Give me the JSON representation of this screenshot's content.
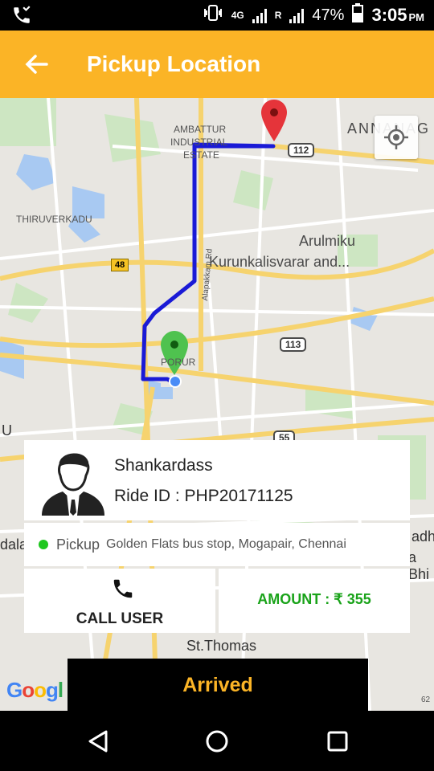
{
  "status_bar": {
    "network": "4G",
    "sim2_label": "R",
    "battery": "47%",
    "time": "3:05",
    "ampm": "PM"
  },
  "app_bar": {
    "title": "Pickup Location"
  },
  "map": {
    "labels": {
      "ambattur": "AMBATTUR",
      "industrial": "INDUSTRIAL",
      "estate": "ESTATE",
      "thiruverkadu": "THIRUVERKADU",
      "anna_nagar": "ANNANAG",
      "arulmiku": "Arulmiku",
      "kurunkalisvarar": "Kurunkalisvarar and...",
      "alapakkam_rd": "Alapakkam Rd",
      "porur": "PORUR",
      "st_thomas": "St.Thomas",
      "adhi": "adhi",
      "bhi": "a Bhi",
      "dala": "dala",
      "u": "U",
      "sixtytwo": "62"
    },
    "shields": {
      "r112": "112",
      "r113": "113",
      "r55": "55",
      "r48": "48"
    },
    "google_logo": "Google"
  },
  "ride": {
    "user_name": "Shankardass",
    "ride_id": "Ride ID : PHP20171125",
    "pickup_label": "Pickup",
    "pickup_address": "Golden Flats bus stop, Mogapair, Chennai",
    "call_label": "CALL USER",
    "amount": "AMOUNT : ₹ 355",
    "action_label": "Arrived"
  },
  "colors": {
    "accent": "#fbb426",
    "route": "#1a1ad6",
    "pickup_dot": "#1ec71e",
    "amount_text": "#1aa31a"
  },
  "icons": [
    "missed-call-icon",
    "vibrate-icon",
    "signal-icon",
    "battery-icon",
    "back-arrow-icon",
    "my-location-icon",
    "destination-pin-icon",
    "pickup-pin-icon",
    "user-avatar-icon",
    "phone-icon",
    "nav-back-icon",
    "nav-home-icon",
    "nav-recents-icon"
  ]
}
